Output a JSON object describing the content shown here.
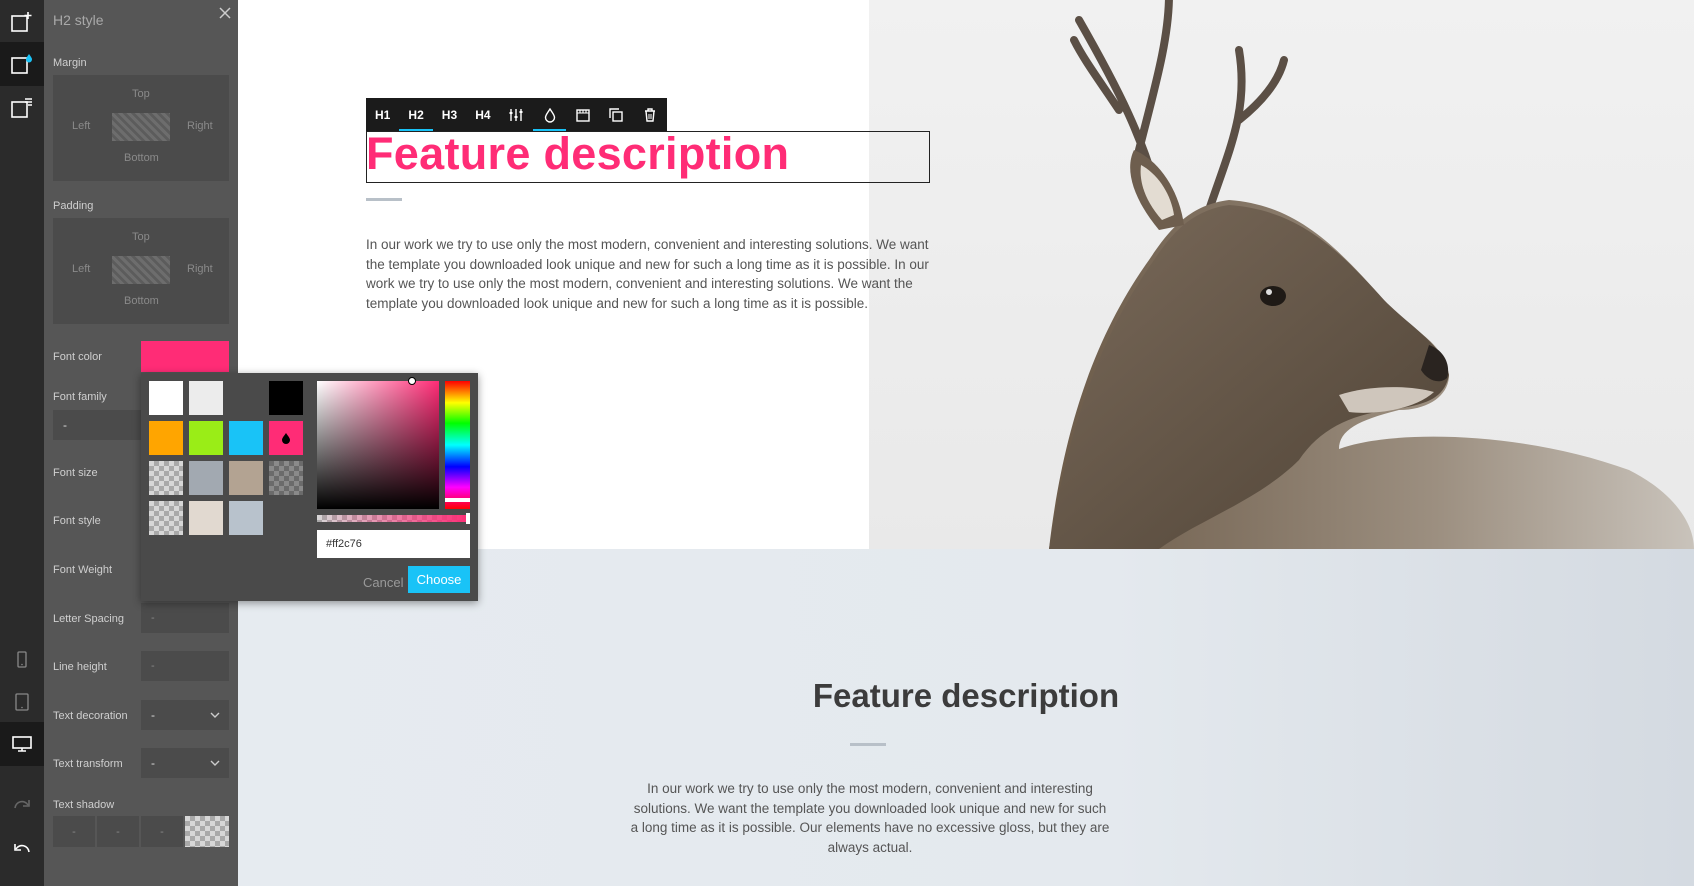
{
  "panel": {
    "title": "H2 style",
    "margin": {
      "label": "Margin",
      "top": "Top",
      "left": "Left",
      "right": "Right",
      "bottom": "Bottom"
    },
    "padding": {
      "label": "Padding",
      "top": "Top",
      "left": "Left",
      "right": "Right",
      "bottom": "Bottom"
    },
    "font_color_label": "Font color",
    "font_color_value": "#ff2c76",
    "font_family_label": "Font family",
    "font_family_value": "-",
    "font_size_label": "Font size",
    "font_style_label": "Font style",
    "font_weight_label": "Font Weight",
    "letter_spacing_label": "Letter Spacing",
    "letter_spacing_value": "-",
    "line_height_label": "Line height",
    "line_height_value": "-",
    "text_decoration_label": "Text decoration",
    "text_decoration_value": "-",
    "text_transform_label": "Text transform",
    "text_transform_value": "-",
    "text_shadow_label": "Text shadow",
    "text_shadow_values": [
      "-",
      "-",
      "-"
    ]
  },
  "picker": {
    "swatches": [
      "#ffffff",
      "#ececec",
      "#4a4a4a",
      "#000000",
      "#ffa500",
      "#9aed17",
      "#19c3f7",
      "#ff2c76",
      "transparent",
      "#a2a9b1",
      "#b3a392",
      "transparent-dark",
      "transparent",
      "#e1d9d0",
      "#b8c2cc"
    ],
    "hex_value": "#ff2c76",
    "cancel_label": "Cancel",
    "choose_label": "Choose"
  },
  "heading_toolbar": {
    "items": [
      "H1",
      "H2",
      "H3",
      "H4"
    ],
    "icons": [
      "sliders-icon",
      "color-drop-icon",
      "image-frame-icon",
      "duplicate-icon",
      "trash-icon"
    ]
  },
  "content": {
    "heading1": "Feature description",
    "paragraph1": "In our work we try to use only the most modern, convenient and interesting solutions. We want the template you downloaded look unique and new for such a long time as it is possible. In our work we try to use only the most modern, convenient and interesting solutions. We want the template you downloaded look unique and new for such a long time as it is possible.",
    "heading2": "Feature description",
    "paragraph2": "In our work we try to use only the most modern, convenient and interesting solutions. We want the template you downloaded look unique and new for such a long time as it is possible. Our elements have no excessive gloss, but they are always actual."
  },
  "colors": {
    "accent": "#ff2c76",
    "primary": "#19c3f7",
    "toolbar_bg": "#2b2b2b",
    "panel_bg": "#565656"
  }
}
